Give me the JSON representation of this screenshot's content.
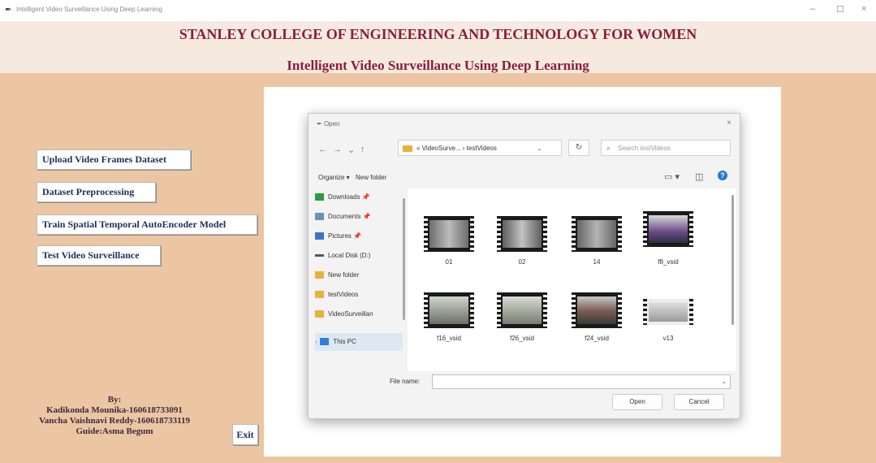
{
  "window": {
    "title": "Intelligent Video Surveillance Using Deep Learning",
    "minimize_glyph": "–",
    "maximize_glyph": "☐",
    "close_glyph": "×"
  },
  "header": {
    "college": "STANLEY COLLEGE OF ENGINEERING AND TECHNOLOGY FOR WOMEN",
    "project": "Intelligent Video Surveillance Using Deep Learning"
  },
  "buttons": {
    "upload": "Upload Video Frames Dataset",
    "preprocess": "Dataset Preprocessing",
    "train": "Train Spatial Temporal AutoEncoder Model",
    "test": "Test Video Surveillance",
    "exit": "Exit"
  },
  "credits": {
    "by": "By:",
    "author1": "Kadikonda Mounika-160618733091",
    "author2": "Vancha Vaishnavi Reddy-160618733119",
    "guide": "Guide:Asma Begum"
  },
  "dialog": {
    "title": "Open",
    "close_glyph": "×",
    "path": "« VideoSurve... › testVideos",
    "search_placeholder": "Search testVideos",
    "organize": "Organize ▾",
    "new_folder": "New folder",
    "nav_items": [
      {
        "label": "Downloads",
        "pinned": "📌"
      },
      {
        "label": "Documents",
        "pinned": "📌"
      },
      {
        "label": "Pictures",
        "pinned": "📌"
      },
      {
        "label": "Local Disk (D:)",
        "pinned": ""
      },
      {
        "label": "New folder",
        "pinned": ""
      },
      {
        "label": "testVideos",
        "pinned": ""
      },
      {
        "label": "VideoSurveillan",
        "pinned": ""
      },
      {
        "label": "This PC",
        "pinned": ""
      }
    ],
    "files": [
      {
        "name": "01"
      },
      {
        "name": "02"
      },
      {
        "name": "14"
      },
      {
        "name": "f8_vsid"
      },
      {
        "name": "f16_vsid"
      },
      {
        "name": "f26_vsid"
      },
      {
        "name": "f24_vsid"
      },
      {
        "name": "v13"
      }
    ],
    "file_name_label": "File name:",
    "file_name_value": "",
    "open_label": "Open",
    "cancel_label": "Cancel"
  }
}
